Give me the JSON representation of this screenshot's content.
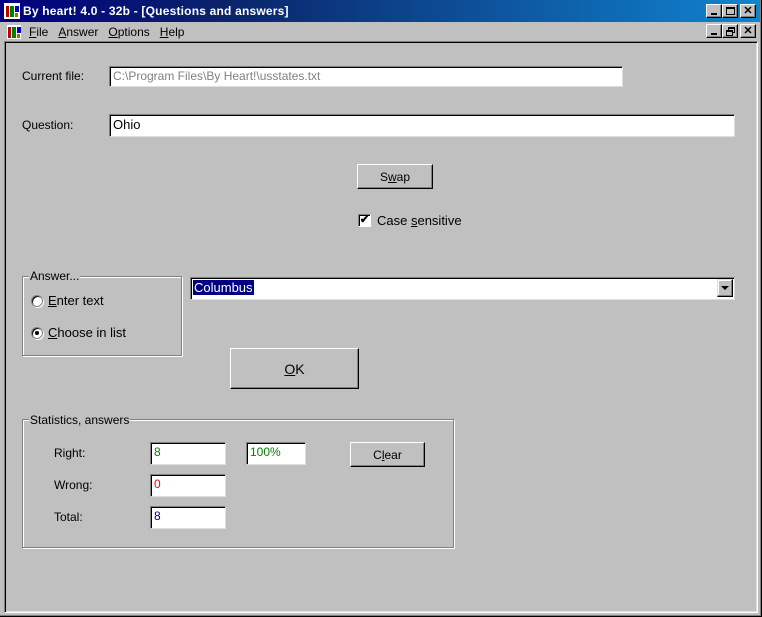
{
  "window": {
    "title": "By heart! 4.0 - 32b - [Questions and answers]",
    "controls": {
      "minimize_icon": "minimize-icon",
      "maximize_icon": "maximize-icon",
      "close_icon": "close-icon",
      "restore_icon": "restore-icon"
    }
  },
  "menu": {
    "items": [
      {
        "label": "File",
        "accel": "F",
        "rest": "ile"
      },
      {
        "label": "Answer",
        "accel": "A",
        "rest": "nswer"
      },
      {
        "label": "Options",
        "accel": "O",
        "rest": "ptions"
      },
      {
        "label": "Help",
        "accel": "H",
        "rest": "elp"
      }
    ]
  },
  "form": {
    "current_file_label": "Current file:",
    "current_file_value": "C:\\Program Files\\By Heart!\\usstates.txt",
    "question_label": "Question:",
    "question_value": "Ohio",
    "swap_button": {
      "pre": "S",
      "accel": "w",
      "post": "ap"
    },
    "case_sensitive": {
      "checked": true,
      "pre": "Case ",
      "accel": "s",
      "post": "ensitive"
    }
  },
  "answer": {
    "group_title": "Answer...",
    "mode_options": [
      {
        "accel": "E",
        "rest": "nter text",
        "selected": false
      },
      {
        "accel": "C",
        "rest": "hoose in list",
        "selected": true
      }
    ],
    "selected_answer": "Columbus",
    "ok_button": {
      "accel": "O",
      "rest": "K"
    }
  },
  "statistics": {
    "group_title": "Statistics, answers",
    "right_label": "Right:",
    "right_value": "8",
    "right_percent": "100%",
    "wrong_label": "Wrong:",
    "wrong_value": "0",
    "total_label": "Total:",
    "total_value": "8",
    "clear_button": {
      "pre": "C",
      "accel": "l",
      "post": "ear"
    },
    "colors": {
      "right": "#008000",
      "wrong": "#ff0000",
      "total": "#000080"
    }
  }
}
